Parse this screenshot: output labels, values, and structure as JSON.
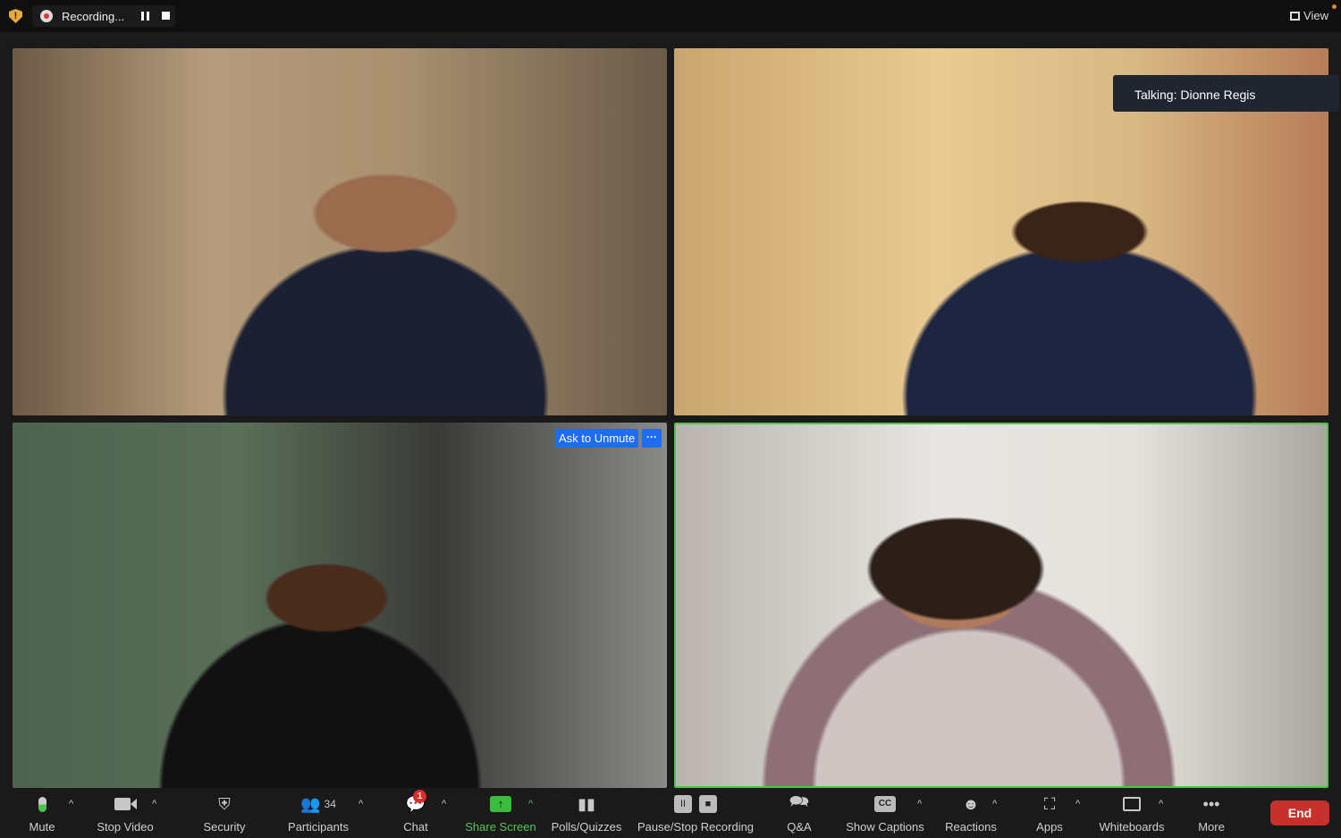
{
  "topbar": {
    "recording_label": "Recording...",
    "view_label": "View"
  },
  "tiles": [
    {
      "id": "participant-1"
    },
    {
      "id": "participant-2",
      "overlay": "Talking: Dionne Regis"
    },
    {
      "id": "participant-3",
      "ask_to_unmute": "Ask to Unmute",
      "more": "···"
    },
    {
      "id": "participant-4",
      "active_speaker": true
    }
  ],
  "toolbar": {
    "mute": "Mute",
    "stop_video": "Stop Video",
    "security": "Security",
    "participants": "Participants",
    "participants_count": "34",
    "chat": "Chat",
    "chat_badge": "1",
    "share_screen": "Share Screen",
    "polls": "Polls/Quizzes",
    "pause_stop_recording": "Pause/Stop Recording",
    "qa": "Q&A",
    "captions": "Show Captions",
    "captions_icon": "CC",
    "reactions": "Reactions",
    "apps": "Apps",
    "whiteboards": "Whiteboards",
    "more": "More",
    "end": "End"
  },
  "colors": {
    "accent_green": "#4cc34c",
    "end_red": "#c6302d",
    "unmute_blue": "#1c6cf5"
  }
}
